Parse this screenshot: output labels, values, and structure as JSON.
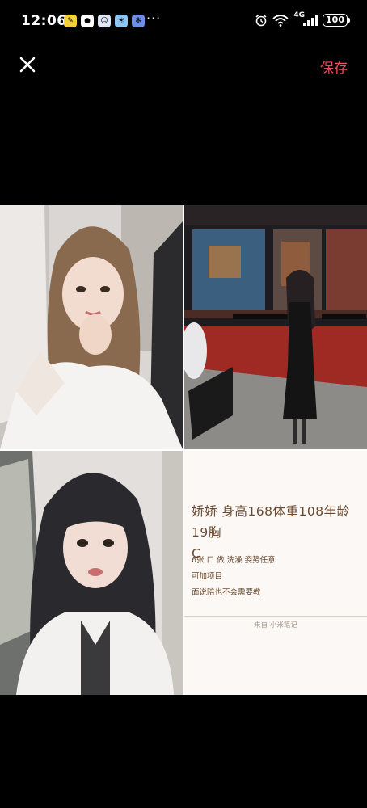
{
  "status_bar": {
    "time": "12:06",
    "network": "4G",
    "battery": "100",
    "icons": [
      "note-icon",
      "qq-icon",
      "chat-bot-icon",
      "weather-icon",
      "photos-icon"
    ]
  },
  "top_bar": {
    "save_label": "保存"
  },
  "colors": {
    "accent": "#e8505b",
    "note_text": "#6b4a2f",
    "note_bg": "#fbf8f6"
  },
  "note_card": {
    "title_line1": "娇娇  身高168体重108年龄19胸",
    "title_line2": "C",
    "lines": [
      "6张  口  做  洗澡  姿势任意",
      "可加项目",
      "面说陪也不会需要教"
    ],
    "source": "来自 小米笔记"
  }
}
